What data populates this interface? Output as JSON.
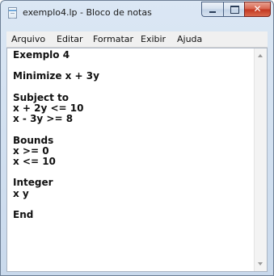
{
  "window": {
    "title": "exemplo4.lp - Bloco de notas",
    "app_icon": "notepad-icon",
    "controls": {
      "minimize_icon": "minimize-icon",
      "maximize_icon": "maximize-icon",
      "close_label": "✕"
    }
  },
  "menu": {
    "items": [
      "Arquivo",
      "Editar",
      "Formatar",
      "Exibir",
      "Ajuda"
    ]
  },
  "editor": {
    "content": "Exemplo 4\n\nMinimize x + 3y\n\nSubject to\nx + 2y <= 10\nx - 3y >= 8\n\nBounds\nx >= 0\nx <= 10\n\nInteger\nx y\n\nEnd"
  },
  "scrollbar": {
    "up_icon": "scroll-up-arrow-icon",
    "down_icon": "scroll-down-arrow-icon"
  }
}
